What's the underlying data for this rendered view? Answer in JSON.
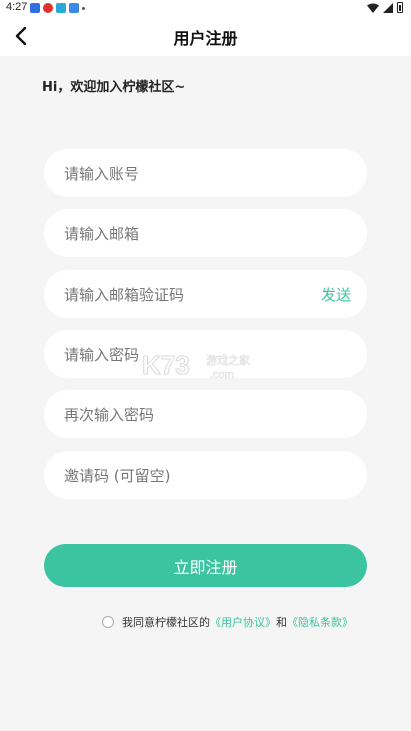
{
  "status_bar": {
    "time": "4:27",
    "notification_icons": [
      {
        "name": "app-icon-blue",
        "color": "#2f6fe0"
      },
      {
        "name": "app-icon-red",
        "color": "#e0302f"
      },
      {
        "name": "app-icon-cyan",
        "color": "#2aa8d8"
      },
      {
        "name": "app-icon-blue-2",
        "color": "#3a88e8"
      }
    ]
  },
  "header": {
    "title": "用户注册"
  },
  "greeting": "Hi，欢迎加入柠檬社区~",
  "form": {
    "account_placeholder": "请输入账号",
    "email_placeholder": "请输入邮箱",
    "code_placeholder": "请输入邮箱验证码",
    "send_label": "发送",
    "password_placeholder": "请输入密码",
    "confirm_placeholder": "再次输入密码",
    "invite_placeholder": "邀请码 (可留空)"
  },
  "watermark": {
    "line1": "K73",
    "line2": "游戏之家",
    "line3": ".com"
  },
  "register_label": "立即注册",
  "agreement": {
    "prefix": "我同意柠檬社区的",
    "user_agreement": "《用户协议》",
    "conjunction": "和",
    "privacy_policy": "《隐私条款》"
  },
  "colors": {
    "accent": "#3cc4a0",
    "background": "#f5f5f5"
  }
}
